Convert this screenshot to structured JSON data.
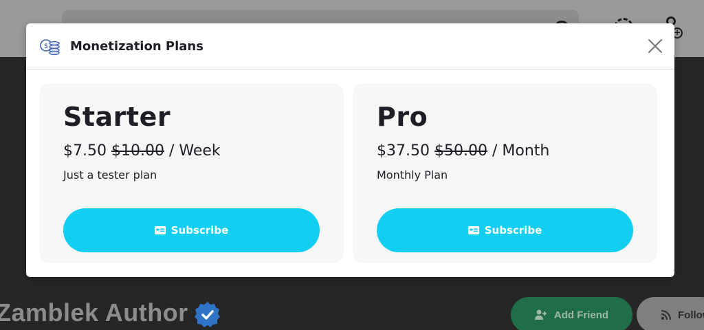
{
  "background": {
    "author_name": "Zamblek Author",
    "add_friend_label": "Add Friend",
    "follow_label": "Follow"
  },
  "modal": {
    "title": "Monetization Plans",
    "plans": [
      {
        "name": "Starter",
        "price": "$7.50",
        "old_price": "$10.00",
        "period": "/ Week",
        "description": "Just a tester plan",
        "subscribe_label": "Subscribe"
      },
      {
        "name": "Pro",
        "price": "$37.50",
        "old_price": "$50.00",
        "period": "/ Month",
        "description": "Monthly Plan",
        "subscribe_label": "Subscribe"
      }
    ]
  },
  "colors": {
    "accent": "#12cef0",
    "add_friend": "#1f6e47",
    "verified_badge": "#2f73c7"
  },
  "icons": [
    "search-icon",
    "refresh-icon",
    "add-user-icon",
    "coins-icon",
    "close-icon",
    "card-icon",
    "verified-icon",
    "rss-icon"
  ]
}
